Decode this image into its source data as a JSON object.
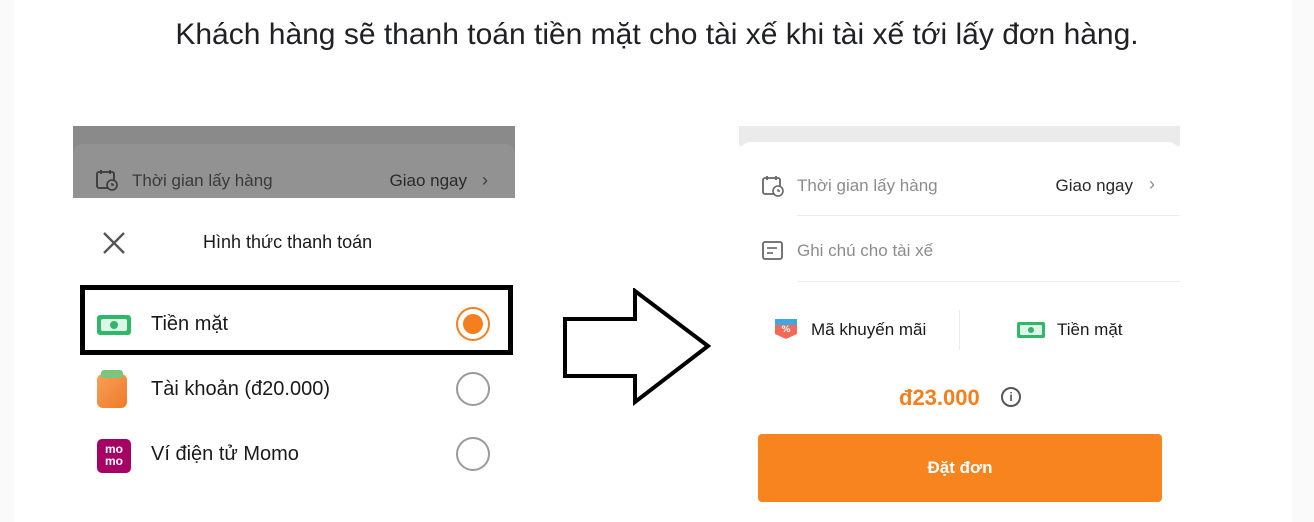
{
  "heading": "Khách hàng sẽ thanh toán tiền mặt cho tài xế khi tài xế tới lấy đơn hàng.",
  "left": {
    "pickup_time_label": "Thời gian lấy hàng",
    "pickup_time_value": "Giao ngay",
    "sheet_title": "Hình thức thanh toán",
    "options": [
      {
        "label": "Tiền mặt",
        "selected": true,
        "icon": "cash-icon"
      },
      {
        "label": "Tài khoản (đ20.000)",
        "selected": false,
        "icon": "wallet-icon"
      },
      {
        "label": "Ví điện tử Momo",
        "selected": false,
        "icon": "momo-icon"
      }
    ],
    "momo_icon_text": [
      "mo",
      "mo"
    ]
  },
  "right": {
    "pickup_time_label": "Thời gian lấy hàng",
    "pickup_time_value": "Giao ngay",
    "driver_note_placeholder": "Ghi chú cho tài xế",
    "promo_label": "Mã khuyến mãi",
    "payment_method": "Tiền mặt",
    "price": "đ23.000",
    "order_button": "Đặt đơn"
  },
  "colors": {
    "accent": "#f57e1e",
    "cash_green": "#2fb86a",
    "momo": "#a50064"
  }
}
